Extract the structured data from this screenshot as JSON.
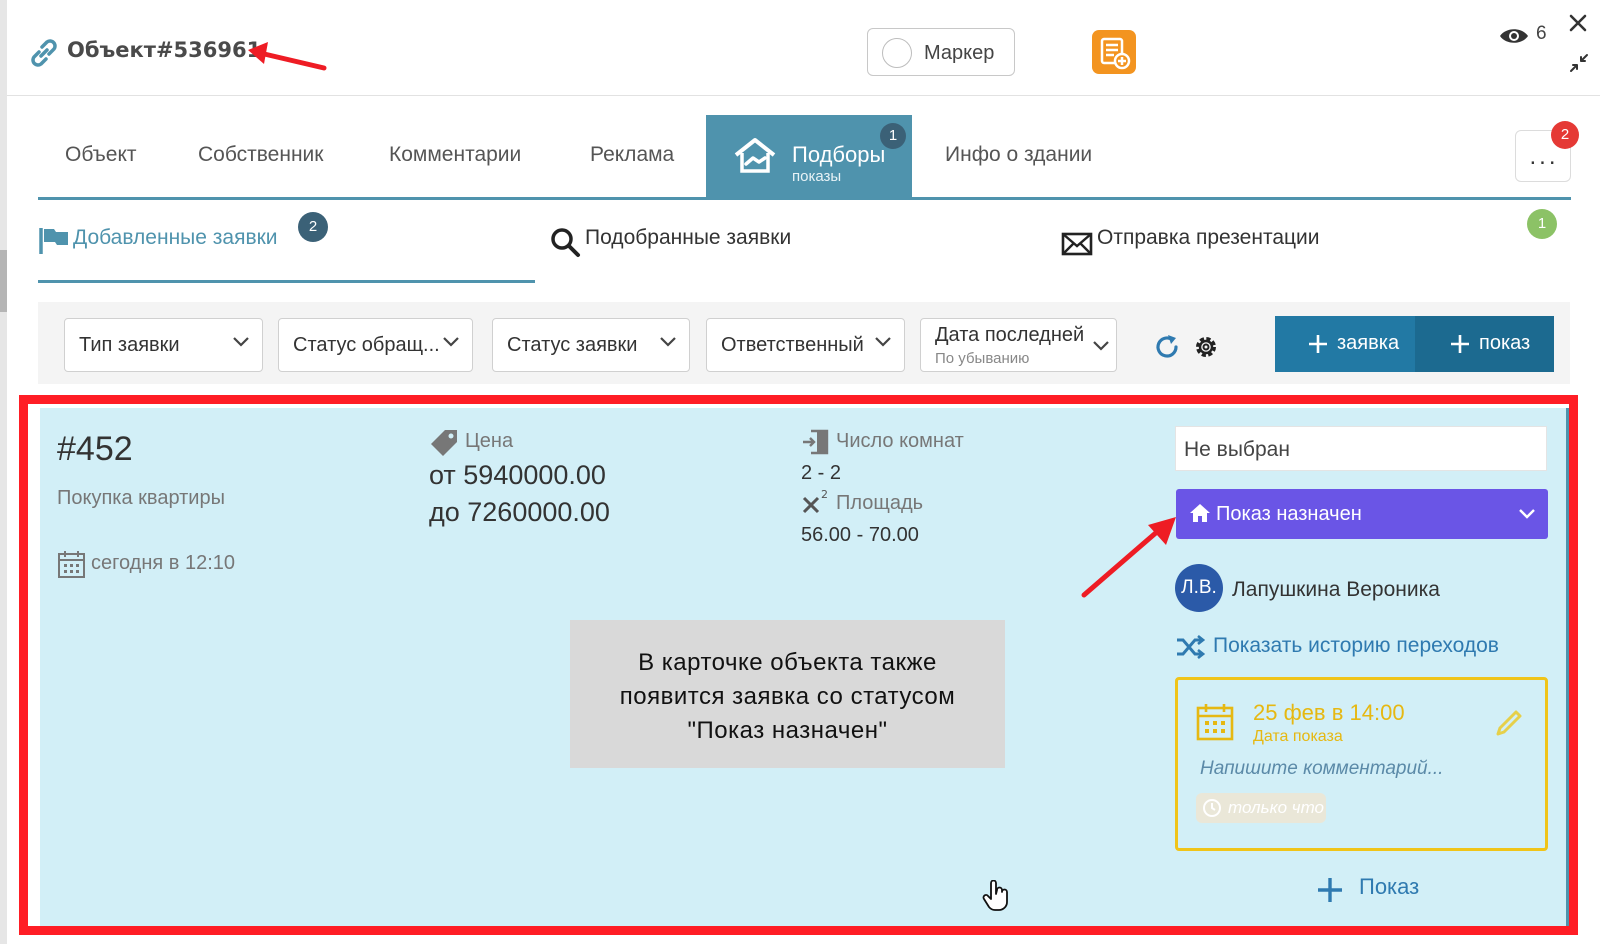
{
  "header": {
    "object_title": "Объект#536961",
    "marker_label": "Маркер",
    "views_count": "6"
  },
  "tabs": [
    {
      "label": "Объект"
    },
    {
      "label": "Собственник"
    },
    {
      "label": "Комментарии"
    },
    {
      "label": "Реклама"
    },
    {
      "label": "Подборы",
      "sublabel": "показы",
      "badge": "1",
      "active": true
    },
    {
      "label": "Инфо о здании"
    }
  ],
  "more": {
    "label": "...",
    "badge": "2"
  },
  "subtabs": {
    "added": {
      "label": "Добавленные заявки",
      "badge": "2"
    },
    "matched": {
      "label": "Подобранные заявки"
    },
    "presentation": {
      "label": "Отправка презентации",
      "badge": "1"
    }
  },
  "filters": {
    "type": "Тип заявки",
    "appeal_status": "Статус обращ...",
    "request_status": "Статус заявки",
    "responsible": "Ответственный",
    "sort_label": "Дата последней",
    "sort_order": "По убыванию"
  },
  "actions": {
    "add_request": "заявка",
    "add_show": "показ"
  },
  "request": {
    "id": "#452",
    "type": "Покупка квартиры",
    "date": "сегодня в 12:10",
    "price_label": "Цена",
    "price_from": "от 5940000.00",
    "price_to": "до 7260000.00",
    "rooms_label": "Число комнат",
    "rooms_value": "2 - 2",
    "area_label": "Площадь",
    "area_value": "56.00 - 70.00",
    "responsible_placeholder": "Не выбран",
    "status": "Показ назначен",
    "agent_initials": "Л.В.",
    "agent_name": "Лапушкина Вероника",
    "history_link": "Показать историю переходов",
    "show": {
      "date": "25 фев в 14:00",
      "date_label": "Дата показа",
      "comment_placeholder": "Напишите комментарий...",
      "time_ago": "только что"
    },
    "add_show_label": "Показ"
  },
  "annotation": {
    "line1": "В карточке объекта также",
    "line2": "появится заявка со статусом",
    "line3": "\"Показ назначен\""
  },
  "colors": {
    "accent": "#4f93ad",
    "status_purple": "#6a55e6",
    "highlight_red": "#ff1d25",
    "card_bg": "#d2eff7",
    "show_yellow": "#f0c419"
  }
}
